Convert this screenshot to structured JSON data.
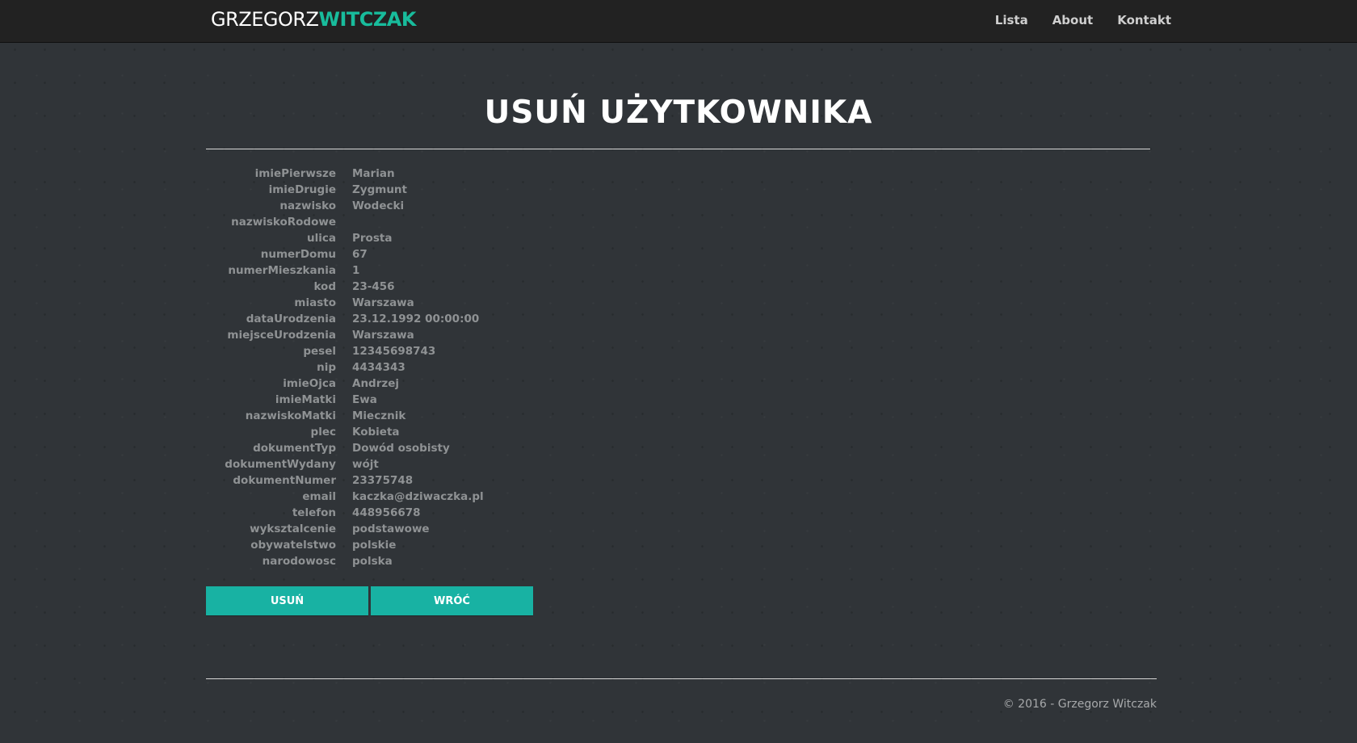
{
  "navbar": {
    "brand_first": "GRZEGORZ",
    "brand_second": "WITCZAK",
    "links": [
      "Lista",
      "About",
      "Kontakt"
    ]
  },
  "page": {
    "title": "USUŃ UŻYTKOWNIKA"
  },
  "details": [
    {
      "label": "imiePierwsze",
      "value": "Marian"
    },
    {
      "label": "imieDrugie",
      "value": "Zygmunt"
    },
    {
      "label": "nazwisko",
      "value": "Wodecki"
    },
    {
      "label": "nazwiskoRodowe",
      "value": ""
    },
    {
      "label": "ulica",
      "value": "Prosta"
    },
    {
      "label": "numerDomu",
      "value": "67"
    },
    {
      "label": "numerMieszkania",
      "value": "1"
    },
    {
      "label": "kod",
      "value": "23-456"
    },
    {
      "label": "miasto",
      "value": "Warszawa"
    },
    {
      "label": "dataUrodzenia",
      "value": "23.12.1992 00:00:00"
    },
    {
      "label": "miejsceUrodzenia",
      "value": "Warszawa"
    },
    {
      "label": "pesel",
      "value": "12345698743"
    },
    {
      "label": "nip",
      "value": "4434343"
    },
    {
      "label": "imieOjca",
      "value": "Andrzej"
    },
    {
      "label": "imieMatki",
      "value": "Ewa"
    },
    {
      "label": "nazwiskoMatki",
      "value": "Miecznik"
    },
    {
      "label": "plec",
      "value": "Kobieta"
    },
    {
      "label": "dokumentTyp",
      "value": "Dowód osobisty"
    },
    {
      "label": "dokumentWydany",
      "value": "wójt"
    },
    {
      "label": "dokumentNumer",
      "value": "23375748"
    },
    {
      "label": "email",
      "value": "kaczka@dziwaczka.pl"
    },
    {
      "label": "telefon",
      "value": "448956678"
    },
    {
      "label": "wyksztalcenie",
      "value": "podstawowe"
    },
    {
      "label": "obywatelstwo",
      "value": "polskie"
    },
    {
      "label": "narodowosc",
      "value": "polska"
    }
  ],
  "actions": {
    "delete_label": "USUŃ",
    "back_label": "WRÓĆ"
  },
  "footer": {
    "copyright": "© 2016 - Grzegorz Witczak"
  },
  "colors": {
    "accent": "#18bc9c",
    "button": "#18b2a3",
    "navbar_bg": "#222222",
    "page_bg": "#303438"
  }
}
